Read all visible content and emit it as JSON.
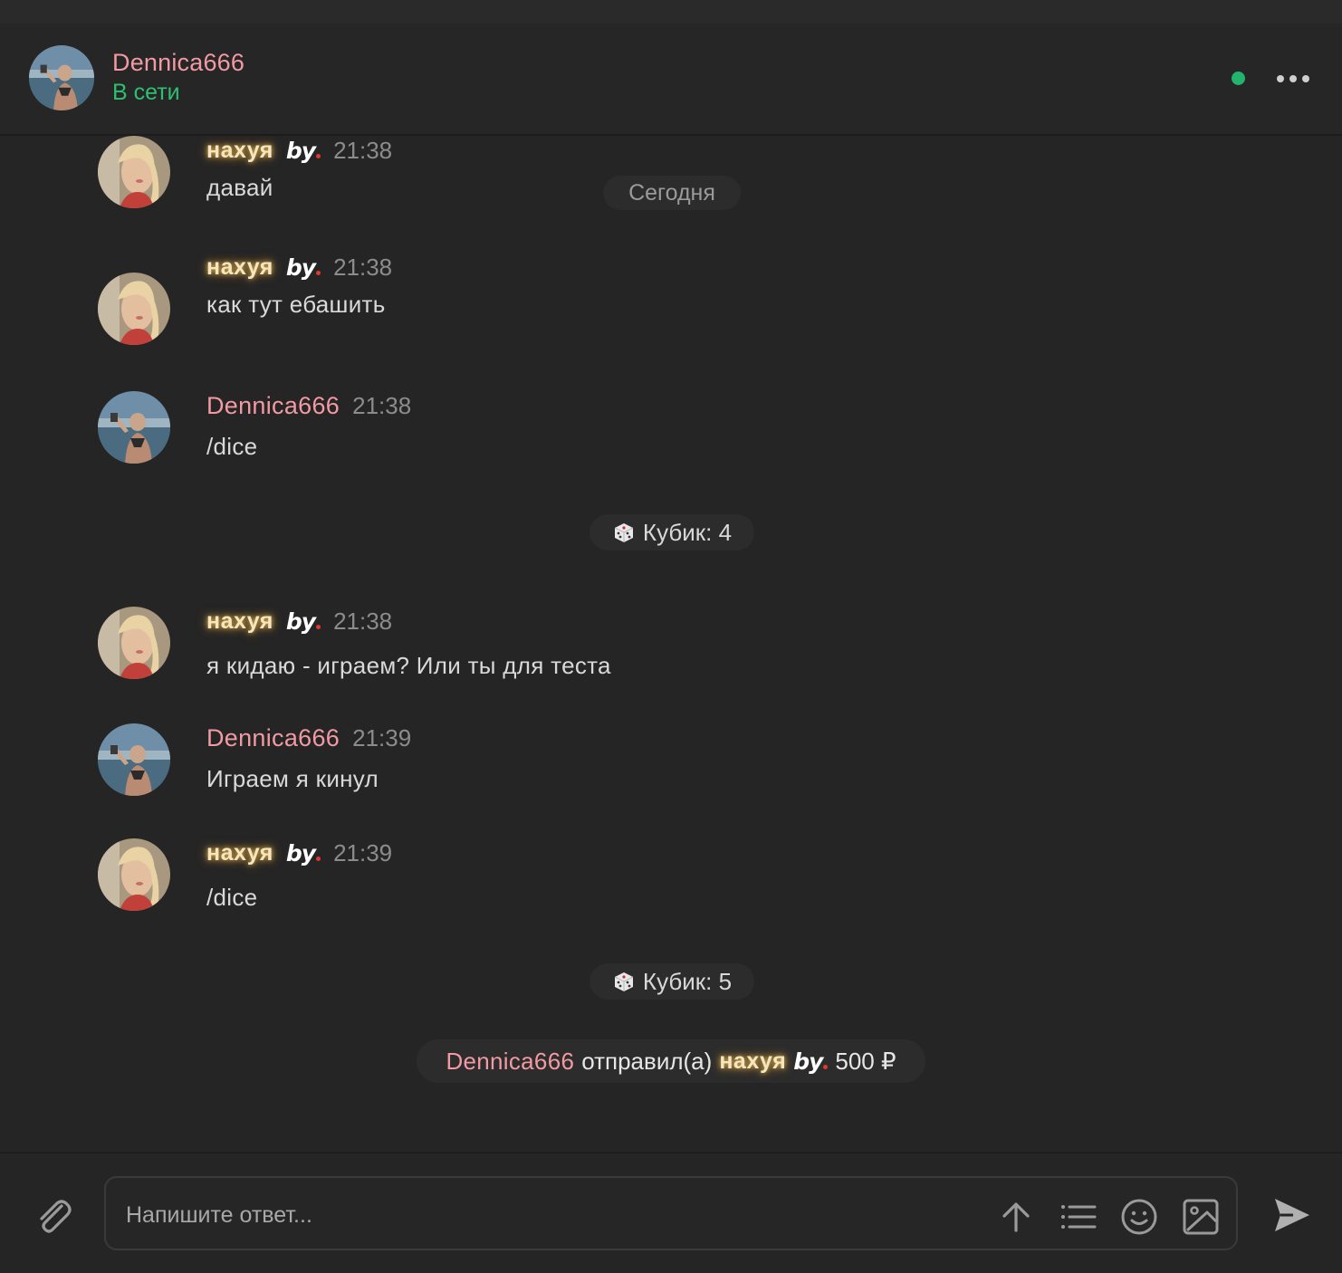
{
  "header": {
    "name": "Dennica666",
    "status": "В сети"
  },
  "chat": {
    "date_label": "Сегодня",
    "messages": [
      {
        "sender": "нахуя",
        "sender_style": "glow",
        "time": "21:38",
        "text": "давай"
      },
      {
        "sender": "нахуя",
        "sender_style": "glow",
        "time": "21:38",
        "text": "как тут ебашить"
      },
      {
        "sender": "Dennica666",
        "sender_style": "pink",
        "time": "21:38",
        "text": "/dice"
      },
      {
        "sender": "нахуя",
        "sender_style": "glow",
        "time": "21:38",
        "text": "я кидаю - играем? Или ты для теста"
      },
      {
        "sender": "Dennica666",
        "sender_style": "pink",
        "time": "21:39",
        "text": "Играем я кинул"
      },
      {
        "sender": "нахуя",
        "sender_style": "glow",
        "time": "21:39",
        "text": "/dice"
      }
    ],
    "by_logo": "by",
    "dice_results": [
      {
        "label": "Кубик: 4"
      },
      {
        "label": "Кубик: 5"
      }
    ],
    "transfer": {
      "from": "Dennica666",
      "action": "отправил(а)",
      "to": "нахуя",
      "amount": "500 ₽"
    }
  },
  "composer": {
    "placeholder": "Напишите ответ..."
  },
  "colors": {
    "accent_pink": "#f29aa3",
    "online_green": "#2fbf71",
    "background": "#252525"
  },
  "icons": [
    "paperclip-icon",
    "arrow-up-icon",
    "list-icon",
    "smiley-icon",
    "image-icon",
    "send-icon",
    "more-icon",
    "dice-icon"
  ]
}
